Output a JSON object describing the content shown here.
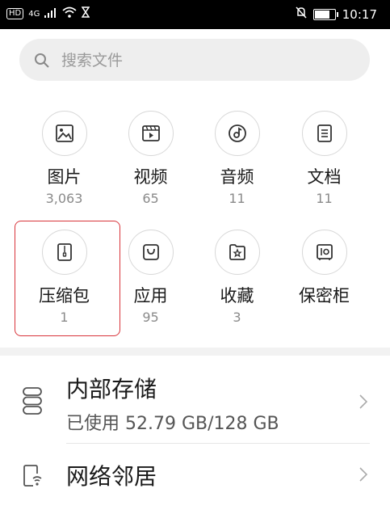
{
  "status_bar": {
    "left_badge": "HD",
    "signal_type": "4G",
    "time": "10:17"
  },
  "search": {
    "placeholder": "搜索文件"
  },
  "categories": [
    {
      "label": "图片",
      "count": "3,063",
      "icon": "image-icon"
    },
    {
      "label": "视频",
      "count": "65",
      "icon": "video-icon"
    },
    {
      "label": "音频",
      "count": "11",
      "icon": "audio-icon"
    },
    {
      "label": "文档",
      "count": "11",
      "icon": "document-icon"
    },
    {
      "label": "压缩包",
      "count": "1",
      "icon": "archive-icon",
      "selected": true
    },
    {
      "label": "应用",
      "count": "95",
      "icon": "app-bag-icon"
    },
    {
      "label": "收藏",
      "count": "3",
      "icon": "favorites-star-icon"
    },
    {
      "label": "保密柜",
      "count": "",
      "icon": "safe-icon"
    }
  ],
  "storage": {
    "title": "内部存储",
    "usage": "已使用 52.79 GB/128 GB"
  },
  "network": {
    "title": "网络邻居"
  },
  "colors": {
    "selection_border": "#d8343a",
    "search_bg": "#eeeeee"
  }
}
